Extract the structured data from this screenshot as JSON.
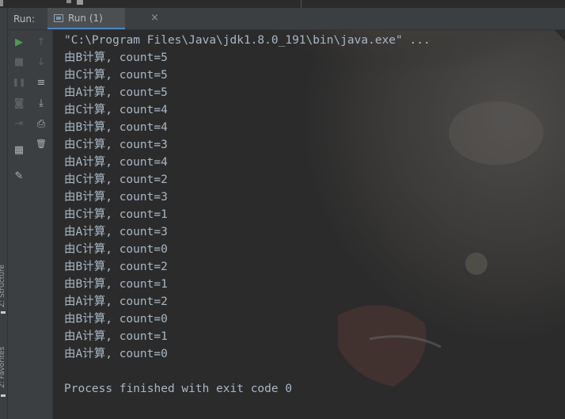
{
  "run_panel": {
    "label": "Run:",
    "tab": {
      "label": "Run (1)",
      "close_glyph": "×"
    }
  },
  "side_tabs": {
    "structure": "Z: Structure",
    "favorites": "2: Favorites"
  },
  "toolbar_left": [
    {
      "icon": "rerun-icon",
      "glyph": "▶",
      "state": "enabled"
    },
    {
      "icon": "stop-icon",
      "glyph": "■",
      "state": "disabled"
    },
    {
      "icon": "pause-icon",
      "glyph": "❚❚",
      "state": "disabled"
    },
    {
      "icon": "camera-icon",
      "glyph": "◙",
      "state": "disabled"
    },
    {
      "icon": "exit-icon",
      "glyph": "⇥",
      "state": "disabled"
    },
    {
      "icon": "layout-icon",
      "glyph": "▦",
      "state": "enabled"
    },
    {
      "icon": "pin-icon",
      "glyph": "✎",
      "state": "enabled"
    }
  ],
  "toolbar_right": [
    {
      "icon": "arrow-up-icon",
      "glyph": "↑",
      "state": "disabled"
    },
    {
      "icon": "arrow-down-icon",
      "glyph": "↓",
      "state": "disabled"
    },
    {
      "icon": "soft-wrap-icon",
      "glyph": "≡",
      "state": "enabled"
    },
    {
      "icon": "scroll-to-end-icon",
      "glyph": "⤓",
      "state": "enabled"
    },
    {
      "icon": "print-icon",
      "glyph": "⎙",
      "state": "enabled"
    },
    {
      "icon": "trash-icon",
      "glyph": "🗑",
      "state": "enabled"
    }
  ],
  "console": {
    "command": "\"C:\\Program Files\\Java\\jdk1.8.0_191\\bin\\java.exe\" ...",
    "output": [
      "由B计算, count=5",
      "由C计算, count=5",
      "由A计算, count=5",
      "由C计算, count=4",
      "由B计算, count=4",
      "由C计算, count=3",
      "由A计算, count=4",
      "由C计算, count=2",
      "由B计算, count=3",
      "由C计算, count=1",
      "由A计算, count=3",
      "由C计算, count=0",
      "由B计算, count=2",
      "由B计算, count=1",
      "由A计算, count=2",
      "由B计算, count=0",
      "由A计算, count=1",
      "由A计算, count=0"
    ],
    "finish_message": "Process finished with exit code 0"
  },
  "colors": {
    "console_bg": "#2b2b2b",
    "panel_bg": "#3c3f41",
    "text": "#a9b7c6",
    "accent": "#4a88c7",
    "run_green": "#499c54"
  }
}
